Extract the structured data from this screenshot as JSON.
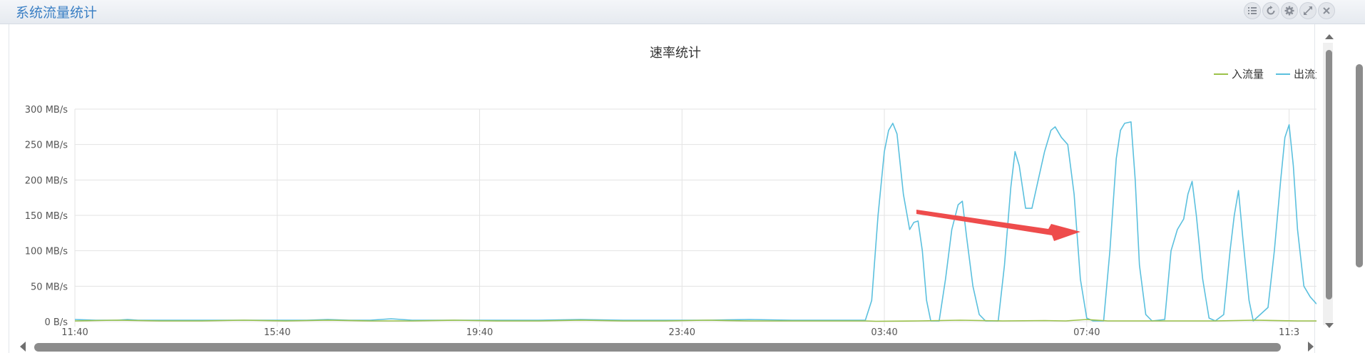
{
  "panel": {
    "title": "系统流量统计",
    "tools": [
      {
        "icon": "list-icon"
      },
      {
        "icon": "refresh-icon"
      },
      {
        "icon": "gear-icon"
      },
      {
        "icon": "expand-icon"
      },
      {
        "icon": "close-icon"
      }
    ]
  },
  "chart_data": {
    "type": "line",
    "title": "速率统计",
    "xlabel": "",
    "ylabel": "",
    "x_ticks": [
      "11:40",
      "15:40",
      "19:40",
      "23:40",
      "03:40",
      "07:40",
      "11:3"
    ],
    "y_ticks": [
      "0 B/s",
      "50 MB/s",
      "100 MB/s",
      "150 MB/s",
      "200 MB/s",
      "250 MB/s",
      "300 MB/s"
    ],
    "ylim": [
      0,
      300
    ],
    "grid": true,
    "legend_position": "top-right",
    "series": [
      {
        "name": "入流量",
        "color": "#9cc24a",
        "points": [
          [
            0,
            1
          ],
          [
            20,
            2
          ],
          [
            40,
            1
          ],
          [
            60,
            1
          ],
          [
            80,
            2
          ],
          [
            100,
            1
          ],
          [
            120,
            2
          ],
          [
            140,
            1
          ],
          [
            160,
            1
          ],
          [
            180,
            2
          ],
          [
            200,
            1
          ],
          [
            220,
            1
          ],
          [
            240,
            2
          ],
          [
            260,
            1
          ],
          [
            280,
            1
          ],
          [
            300,
            2
          ],
          [
            320,
            1
          ],
          [
            340,
            1
          ],
          [
            360,
            1
          ],
          [
            375,
            1
          ],
          [
            380,
            0.5
          ],
          [
            400,
            1
          ],
          [
            420,
            2
          ],
          [
            440,
            1
          ],
          [
            460,
            1.5
          ],
          [
            470,
            1
          ],
          [
            480,
            3
          ],
          [
            490,
            1
          ],
          [
            500,
            1
          ],
          [
            520,
            1
          ],
          [
            540,
            1
          ],
          [
            560,
            2
          ],
          [
            580,
            1
          ],
          [
            600,
            1
          ],
          [
            620,
            1
          ],
          [
            630,
            1
          ],
          [
            640,
            3
          ],
          [
            650,
            1
          ],
          [
            660,
            1
          ]
        ]
      },
      {
        "name": "出流量",
        "color": "#5bc0de",
        "points": [
          [
            0,
            3
          ],
          [
            10,
            2
          ],
          [
            20,
            2
          ],
          [
            25,
            3
          ],
          [
            30,
            2
          ],
          [
            40,
            2
          ],
          [
            60,
            2
          ],
          [
            80,
            2
          ],
          [
            100,
            2
          ],
          [
            110,
            2
          ],
          [
            120,
            3
          ],
          [
            130,
            2
          ],
          [
            140,
            2
          ],
          [
            150,
            4
          ],
          [
            155,
            3
          ],
          [
            160,
            2
          ],
          [
            180,
            2
          ],
          [
            200,
            2
          ],
          [
            220,
            2
          ],
          [
            240,
            3
          ],
          [
            260,
            2
          ],
          [
            280,
            2
          ],
          [
            300,
            2
          ],
          [
            320,
            3
          ],
          [
            340,
            2
          ],
          [
            360,
            2
          ],
          [
            370,
            2
          ],
          [
            375,
            2
          ],
          [
            378,
            30
          ],
          [
            381,
            150
          ],
          [
            384,
            240
          ],
          [
            386,
            270
          ],
          [
            388,
            280
          ],
          [
            390,
            265
          ],
          [
            393,
            180
          ],
          [
            396,
            130
          ],
          [
            398,
            140
          ],
          [
            400,
            142
          ],
          [
            402,
            100
          ],
          [
            404,
            30
          ],
          [
            406,
            1
          ],
          [
            410,
            1
          ],
          [
            413,
            60
          ],
          [
            416,
            130
          ],
          [
            419,
            165
          ],
          [
            421,
            170
          ],
          [
            423,
            120
          ],
          [
            426,
            50
          ],
          [
            429,
            10
          ],
          [
            432,
            1
          ],
          [
            438,
            1
          ],
          [
            441,
            80
          ],
          [
            444,
            190
          ],
          [
            446,
            240
          ],
          [
            448,
            220
          ],
          [
            451,
            160
          ],
          [
            454,
            160
          ],
          [
            457,
            200
          ],
          [
            460,
            240
          ],
          [
            463,
            270
          ],
          [
            465,
            275
          ],
          [
            468,
            260
          ],
          [
            471,
            250
          ],
          [
            474,
            180
          ],
          [
            477,
            60
          ],
          [
            480,
            5
          ],
          [
            483,
            1
          ],
          [
            488,
            1
          ],
          [
            491,
            100
          ],
          [
            494,
            230
          ],
          [
            496,
            270
          ],
          [
            498,
            280
          ],
          [
            501,
            282
          ],
          [
            503,
            200
          ],
          [
            505,
            80
          ],
          [
            508,
            10
          ],
          [
            511,
            1
          ],
          [
            517,
            3
          ],
          [
            520,
            100
          ],
          [
            523,
            130
          ],
          [
            526,
            145
          ],
          [
            528,
            180
          ],
          [
            530,
            198
          ],
          [
            532,
            150
          ],
          [
            535,
            60
          ],
          [
            538,
            5
          ],
          [
            541,
            1
          ],
          [
            545,
            10
          ],
          [
            548,
            100
          ],
          [
            550,
            150
          ],
          [
            552,
            185
          ],
          [
            554,
            120
          ],
          [
            557,
            30
          ],
          [
            559,
            1
          ],
          [
            566,
            20
          ],
          [
            569,
            100
          ],
          [
            572,
            200
          ],
          [
            574,
            260
          ],
          [
            576,
            278
          ],
          [
            578,
            220
          ],
          [
            580,
            130
          ],
          [
            583,
            50
          ],
          [
            586,
            35
          ],
          [
            589,
            25
          ]
        ]
      }
    ],
    "annotation": {
      "type": "arrow",
      "color": "#ee4c4c"
    }
  }
}
